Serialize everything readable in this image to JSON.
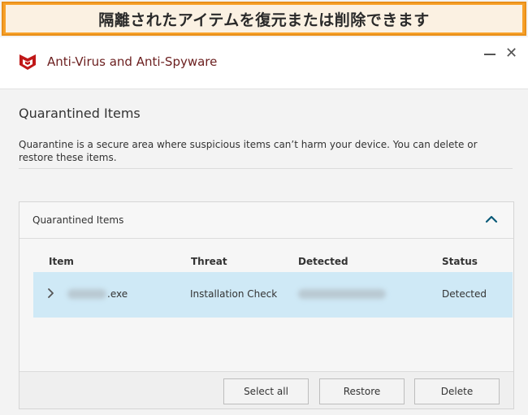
{
  "banner": {
    "text": "隔離されたアイテムを復元または削除できます"
  },
  "app": {
    "title": "Anti-Virus and Anti-Spyware",
    "brand_color": "#c01818"
  },
  "page": {
    "title": "Quarantined Items",
    "description": "Quarantine is a secure area where suspicious items can’t harm your device. You can delete or restore these items."
  },
  "panel": {
    "title": "Quarantined Items",
    "columns": [
      "Item",
      "Threat",
      "Detected",
      "Status"
    ],
    "rows": [
      {
        "item_suffix": ".exe",
        "threat": "Installation Check",
        "status": "Detected"
      }
    ],
    "selected_row_color": "#cfe9f6"
  },
  "actions": {
    "select_all": "Select all",
    "restore": "Restore",
    "delete": "Delete"
  },
  "icons": {
    "logo": "mcafee-shield-icon",
    "minimize": "minimize-icon",
    "close": "close-icon",
    "collapse": "chevron-up-icon",
    "expand_row": "chevron-right-icon"
  }
}
